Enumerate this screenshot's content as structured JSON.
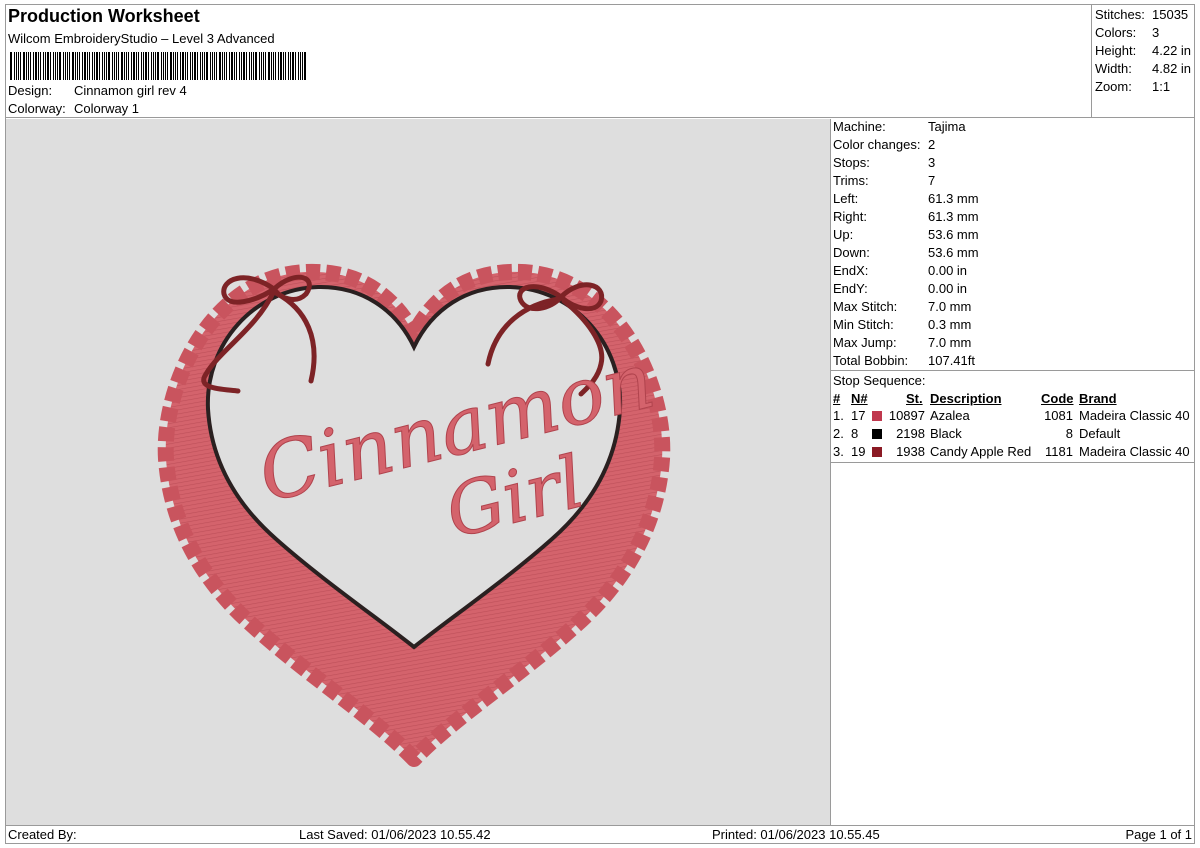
{
  "header": {
    "title": "Production Worksheet",
    "subtitle": "Wilcom EmbroideryStudio – Level 3 Advanced",
    "design_label": "Design:",
    "design_value": "Cinnamon girl rev 4",
    "colorway_label": "Colorway:",
    "colorway_value": "Colorway 1"
  },
  "stats": [
    {
      "label": "Stitches:",
      "value": "15035"
    },
    {
      "label": "Colors:",
      "value": "3"
    },
    {
      "label": "Height:",
      "value": "4.22 in"
    },
    {
      "label": "Width:",
      "value": "4.82 in"
    },
    {
      "label": "Zoom:",
      "value": "1:1"
    }
  ],
  "machine_info": [
    {
      "label": "Machine:",
      "value": "Tajima"
    },
    {
      "label": "Color changes:",
      "value": "2"
    },
    {
      "label": "Stops:",
      "value": "3"
    },
    {
      "label": "Trims:",
      "value": "7"
    },
    {
      "label": "Left:",
      "value": "61.3 mm"
    },
    {
      "label": "Right:",
      "value": "61.3 mm"
    },
    {
      "label": "Up:",
      "value": "53.6 mm"
    },
    {
      "label": "Down:",
      "value": "53.6 mm"
    },
    {
      "label": "EndX:",
      "value": "0.00 in"
    },
    {
      "label": "EndY:",
      "value": "0.00 in"
    },
    {
      "label": "Max Stitch:",
      "value": "7.0 mm"
    },
    {
      "label": "Min Stitch:",
      "value": "0.3 mm"
    },
    {
      "label": "Max Jump:",
      "value": "7.0 mm"
    },
    {
      "label": "Total Bobbin:",
      "value": "107.41ft"
    }
  ],
  "stop_sequence": {
    "title": "Stop Sequence:",
    "columns": {
      "num": "#",
      "needle": "N#",
      "stitches": "St.",
      "description": "Description",
      "code": "Code",
      "brand": "Brand"
    },
    "rows": [
      {
        "num": "1.",
        "needle": "17",
        "color": "#c0384e",
        "stitches": "10897",
        "description": "Azalea",
        "code": "1081",
        "brand": "Madeira Classic 40"
      },
      {
        "num": "2.",
        "needle": "8",
        "color": "#000000",
        "stitches": "2198",
        "description": "Black",
        "code": "8",
        "brand": "Default"
      },
      {
        "num": "3.",
        "needle": "19",
        "color": "#8b1a24",
        "stitches": "1938",
        "description": "Candy Apple Red",
        "code": "1181",
        "brand": "Madeira Classic 40"
      }
    ]
  },
  "design_preview": {
    "text_line1": "Cinnamon",
    "text_line2": "Girl",
    "fill_color": "#d4636c",
    "outline_color": "#2a2020",
    "ribbon_color": "#7d2326"
  },
  "footer": {
    "created_by": "Created By:",
    "last_saved": "Last Saved: 01/06/2023 10.55.42",
    "printed": "Printed: 01/06/2023 10.55.45",
    "page": "Page 1 of 1"
  }
}
